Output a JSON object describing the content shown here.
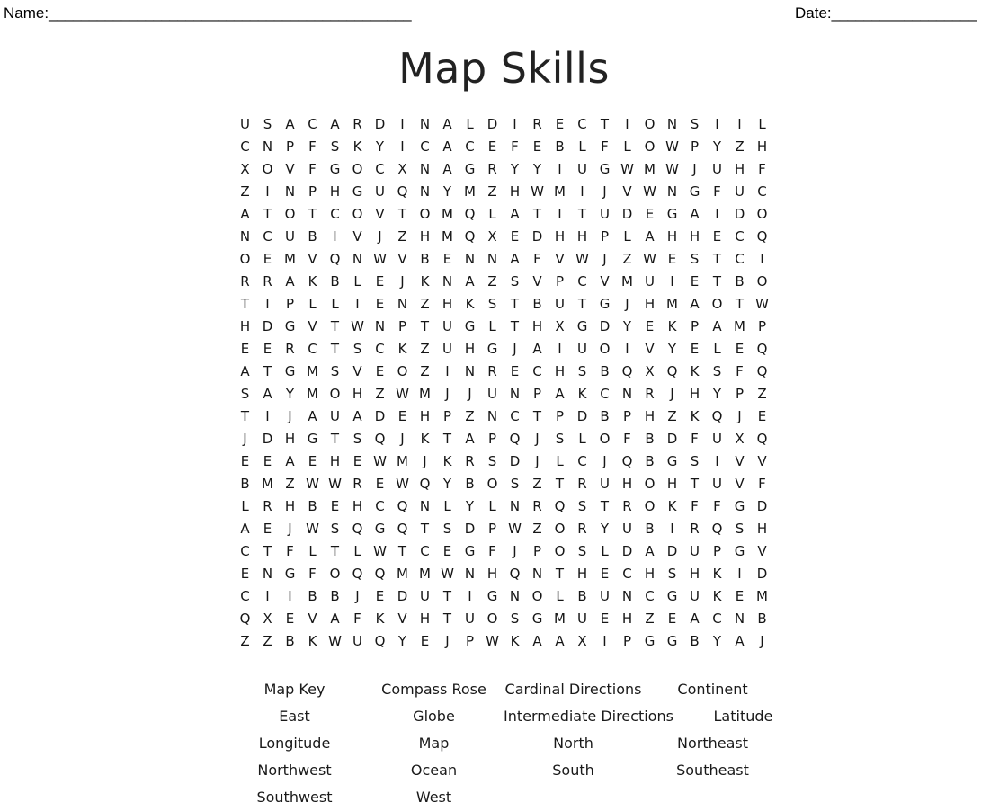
{
  "header": {
    "name_label": "Name:",
    "name_rule": "_____________________________________________",
    "date_label": "Date:",
    "date_rule": "__________________"
  },
  "title": "Map Skills",
  "puzzle": {
    "rows": 24,
    "cols": 24,
    "grid": [
      "USACARDINALDIRECTIONSIIL",
      "CNPFSKYICACEFEBLFLOWPYZH",
      "XOVFGOCXNAGRYYIUGWMWJUHF",
      "ZINPHGUQNYMZHWMIJVWNGFUC",
      "ATOTCOVTOMQLATITUDEGAIDO",
      "NCUBIVJZHMQXEDHHPLAHHECQ",
      "OEMVQNWVBENNAFVWJZWESTCI",
      "RRAKBLEJKNAZSVPCVMUIETBO",
      "TIPLLIENZHKSTBUTGJHMAOTW",
      "HDGVTWNPTUGLTHXGDYEKPAMP",
      "EERCTSCKZUHGJAIUOIVYELEQ",
      "ATGMSVEOZINRECHSBQXQKSFQ",
      "SAYMOHZWMJJUNPAKCNRJHYPZ",
      "TIJAUADEHPZNCTPDBPHZKQJE",
      "JDHGTSQJKTAPQJSLOFBDFUXQ",
      "EEAEHEWMJKRSDJLCJQBGSIVV",
      "BMZWWREWQYBOSZTRUHOHTUVF",
      "LRHBEHCQNLYLNRQSTROKFFGD",
      "AEJWSQGQTSDPWZORYUBIRQSH",
      "CTFLTLWTCEGFJPOSLDADUPGV",
      "ENGFOQQMMWNHQNTHECHSHKID",
      "CIIBBJEDUTIGNOLBUNCGUKEM",
      "QXEVAFKVHTUOSGMUEHZEACNB",
      "ZZBKWUQYEJPWKAAXIPGGBYAJ"
    ]
  },
  "word_list": {
    "rows": [
      [
        "Map Key",
        "Compass Rose",
        "Cardinal Directions",
        "Continent"
      ],
      [
        "East",
        "Globe",
        "Intermediate Directions",
        "Latitude"
      ],
      [
        "Longitude",
        "Map",
        "North",
        "Northeast"
      ],
      [
        "Northwest",
        "Ocean",
        "South",
        "Southeast"
      ],
      [
        "Southwest",
        "West",
        "",
        ""
      ]
    ]
  },
  "colors": {
    "page_background": "#ffffff",
    "text": "#1a1a1a",
    "title": "#222222"
  }
}
